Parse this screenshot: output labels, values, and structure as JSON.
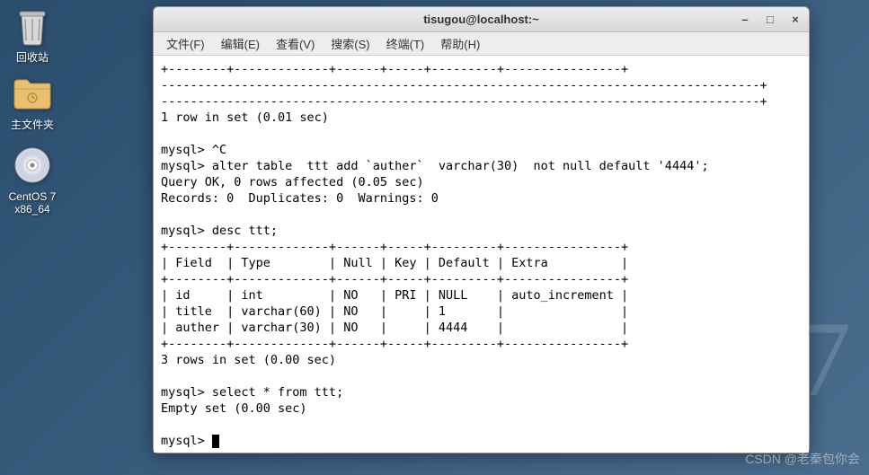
{
  "desktop": {
    "trash_label": "回收站",
    "home_label": "主文件夹",
    "disc_label_line1": "CentOS 7",
    "disc_label_line2": "x86_64"
  },
  "terminal": {
    "title": "tisugou@localhost:~",
    "menu": {
      "file": "文件(F)",
      "edit": "编辑(E)",
      "view": "查看(V)",
      "search": "搜索(S)",
      "terminal": "终端(T)",
      "help": "帮助(H)"
    },
    "lines": {
      "l0": "+--------+-------------+------+-----+---------+----------------+",
      "l1": "----------------------------------------------------------------------------------+",
      "l2": "----------------------------------------------------------------------------------+",
      "l3": "1 row in set (0.01 sec)",
      "l4": "",
      "l5": "mysql> ^C",
      "l6": "mysql> alter table  ttt add `auther`  varchar(30)  not null default '4444';",
      "l7": "Query OK, 0 rows affected (0.05 sec)",
      "l8": "Records: 0  Duplicates: 0  Warnings: 0",
      "l9": "",
      "l10": "mysql> desc ttt;",
      "l11": "+--------+-------------+------+-----+---------+----------------+",
      "l12": "| Field  | Type        | Null | Key | Default | Extra          |",
      "l13": "+--------+-------------+------+-----+---------+----------------+",
      "l14": "| id     | int         | NO   | PRI | NULL    | auto_increment |",
      "l15": "| title  | varchar(60) | NO   |     | 1       |                |",
      "l16": "| auther | varchar(30) | NO   |     | 4444    |                |",
      "l17": "+--------+-------------+------+-----+---------+----------------+",
      "l18": "3 rows in set (0.00 sec)",
      "l19": "",
      "l20": "mysql> select * from ttt;",
      "l21": "Empty set (0.00 sec)",
      "l22": "",
      "l23": "mysql> "
    }
  },
  "watermark": "CSDN @老秦包你会"
}
